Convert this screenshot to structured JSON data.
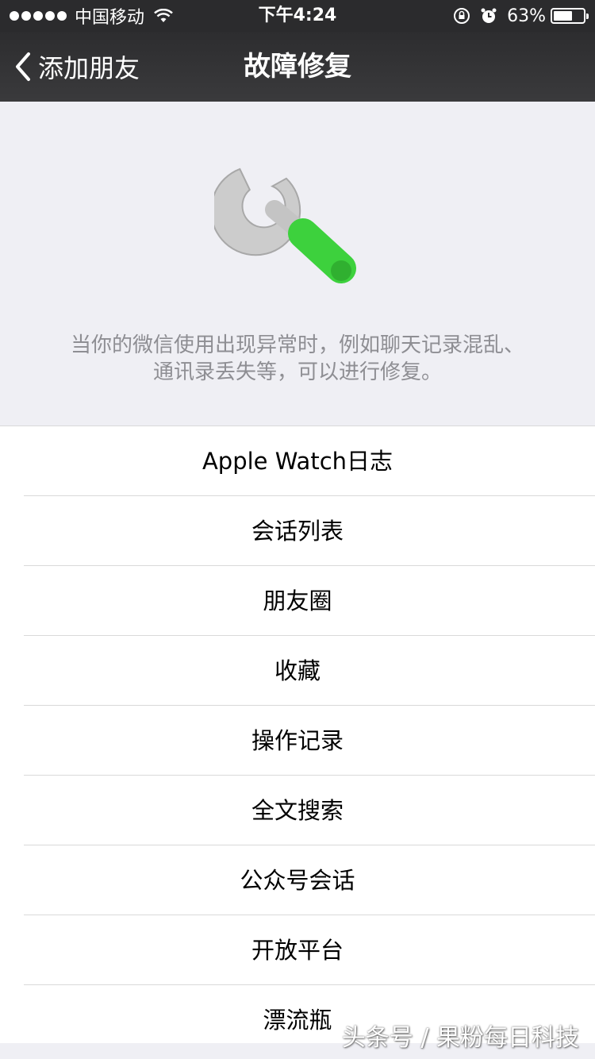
{
  "status_bar": {
    "carrier": "中国移动",
    "time": "下午4:24",
    "battery_percent": "63%",
    "battery_level": 0.63
  },
  "nav": {
    "back_label": "添加朋友",
    "title": "故障修复"
  },
  "header": {
    "icon": "wrench-icon",
    "description": "当你的微信使用出现异常时，例如聊天记录混乱、通讯录丢失等，可以进行修复。"
  },
  "list": {
    "items": [
      {
        "label": "Apple Watch日志"
      },
      {
        "label": "会话列表"
      },
      {
        "label": "朋友圈"
      },
      {
        "label": "收藏"
      },
      {
        "label": "操作记录"
      },
      {
        "label": "全文搜索"
      },
      {
        "label": "公众号会话"
      },
      {
        "label": "开放平台"
      },
      {
        "label": "漂流瓶"
      }
    ]
  },
  "watermark": "头条号 / 果粉每日科技",
  "colors": {
    "nav_background": "#2d2d2f",
    "page_background": "#efeff4",
    "wrench_handle": "#3dd13d",
    "wrench_head": "#c8c8c8",
    "description_text": "#8e8e93"
  }
}
